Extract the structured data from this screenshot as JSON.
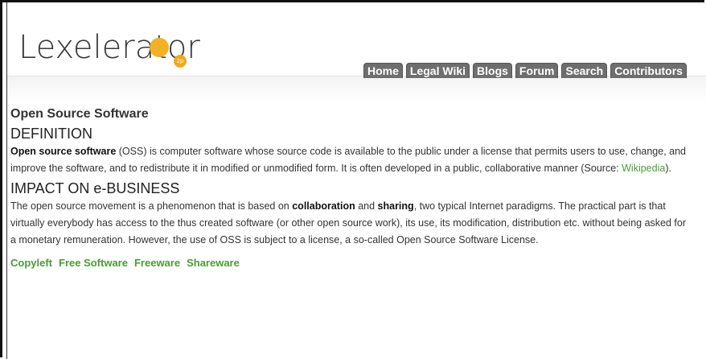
{
  "logo": {
    "text": "Lexelerator",
    "badge": "2p",
    "colors": {
      "primary": "#f2b224",
      "text": "#3a3a3a"
    }
  },
  "nav": {
    "items": [
      {
        "label": "Home"
      },
      {
        "label": "Legal Wiki"
      },
      {
        "label": "Blogs"
      },
      {
        "label": "Forum"
      },
      {
        "label": "Search"
      },
      {
        "label": "Contributors"
      }
    ]
  },
  "page": {
    "title": "Open Source Software",
    "definition": {
      "heading": "DEFINITION",
      "term": "Open source software",
      "text_before_link": " (OSS) is computer software whose source code is available to the public under a  license that permits users to use, change, and improve the software, and to redistribute it in modified or unmodified form. It is often developed in a public, collaborative manner (Source: ",
      "link": "Wikipedia",
      "text_after_link": ")."
    },
    "impact": {
      "heading": "IMPACT ON e-BUSINESS",
      "text_1": "The open source movement is a phenomenon that is based on ",
      "bold_1": "collaboration",
      "text_2": " and ",
      "bold_2": "sharing",
      "text_3": ", two typical Internet paradigms. The practical part is that virtually everybody has access to the thus created software (or other open source work), its use, its modification, distribution etc. without being asked for a monetary remuneration. However, the use of OSS is subject to a license, a so-called Open Source Software License."
    },
    "tags": [
      "Copyleft",
      "Free Software",
      "Freeware",
      "Shareware"
    ]
  },
  "colors": {
    "link": "#4b9a36",
    "nav_bg": "#6e6e6e"
  }
}
